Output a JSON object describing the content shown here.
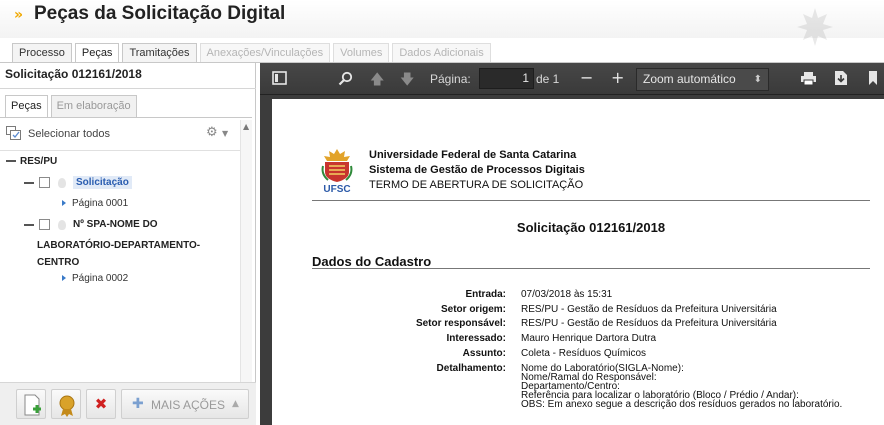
{
  "header": {
    "chevron": "»",
    "title": "Peças da Solicitação Digital"
  },
  "tabs": [
    {
      "label": "Processo",
      "state": "normal"
    },
    {
      "label": "Peças",
      "state": "active"
    },
    {
      "label": "Tramitações",
      "state": "normal"
    },
    {
      "label": "Anexações/Vinculações",
      "state": "disabled"
    },
    {
      "label": "Volumes",
      "state": "disabled"
    },
    {
      "label": "Dados Adicionais",
      "state": "disabled"
    }
  ],
  "left": {
    "title": "Solicitação 012161/2018",
    "subtabs": [
      {
        "label": "Peças",
        "active": true
      },
      {
        "label": "Em elaboração",
        "active": false
      }
    ],
    "select_all": "Selecionar todos",
    "tree": {
      "root": "RES/PU",
      "items": [
        {
          "label": "Solicitação",
          "page": "Página 0001"
        },
        {
          "label_lines": [
            "Nº SPA-NOME DO",
            "LABORATÓRIO-DEPARTAMENTO-",
            "CENTRO"
          ],
          "page": "Página 0002"
        }
      ]
    },
    "more_actions": "MAIS AÇÕES"
  },
  "viewer": {
    "page_label": "Página:",
    "page_value": "1",
    "page_of": "de 1",
    "zoom": "Zoom automático",
    "document": {
      "institution": [
        "Universidade Federal de Santa Catarina",
        "Sistema de Gestão de Processos Digitais",
        "TERMO DE ABERTURA DE SOLICITAÇÃO"
      ],
      "seal_text": "UFSC",
      "title": "Solicitação 012161/2018",
      "section": "Dados do Cadastro",
      "fields": [
        {
          "label": "Entrada:",
          "value": "07/03/2018 às 15:31"
        },
        {
          "label": "Setor origem:",
          "value": "RES/PU - Gestão de Resíduos da Prefeitura Universitária"
        },
        {
          "label": "Setor responsável:",
          "value": "RES/PU - Gestão de Resíduos da Prefeitura Universitária"
        },
        {
          "label": "Interessado:",
          "value": "Mauro Henrique Dartora Dutra"
        },
        {
          "label": "Assunto:",
          "value": "Coleta - Resíduos Químicos"
        }
      ],
      "detalhamento": {
        "label": "Detalhamento:",
        "lines": [
          "Nome do Laboratório(SIGLA-Nome):",
          "Nome/Ramal do Responsável:",
          "Departamento/Centro:",
          "Referência para localizar o laboratório (Bloco / Prédio / Andar):",
          "OBS: Em anexo segue a descrição dos resíduos gerados no laboratório."
        ]
      }
    }
  },
  "icons": {
    "sidebar_toggle": "sidebar-toggle-icon",
    "search": "search-icon",
    "prev": "arrow-up-icon",
    "next": "arrow-down-icon",
    "zoom_out": "minus-icon",
    "zoom_in": "plus-icon",
    "print": "printer-icon",
    "download": "download-icon",
    "bookmark": "bookmark-icon"
  },
  "colors": {
    "accent_chevron": "#f0a800",
    "viewer_toolbar": "#3c3c3c",
    "selected_item": "#2a5db0",
    "delete_red": "#d02020",
    "add_green": "#3aa03a"
  }
}
